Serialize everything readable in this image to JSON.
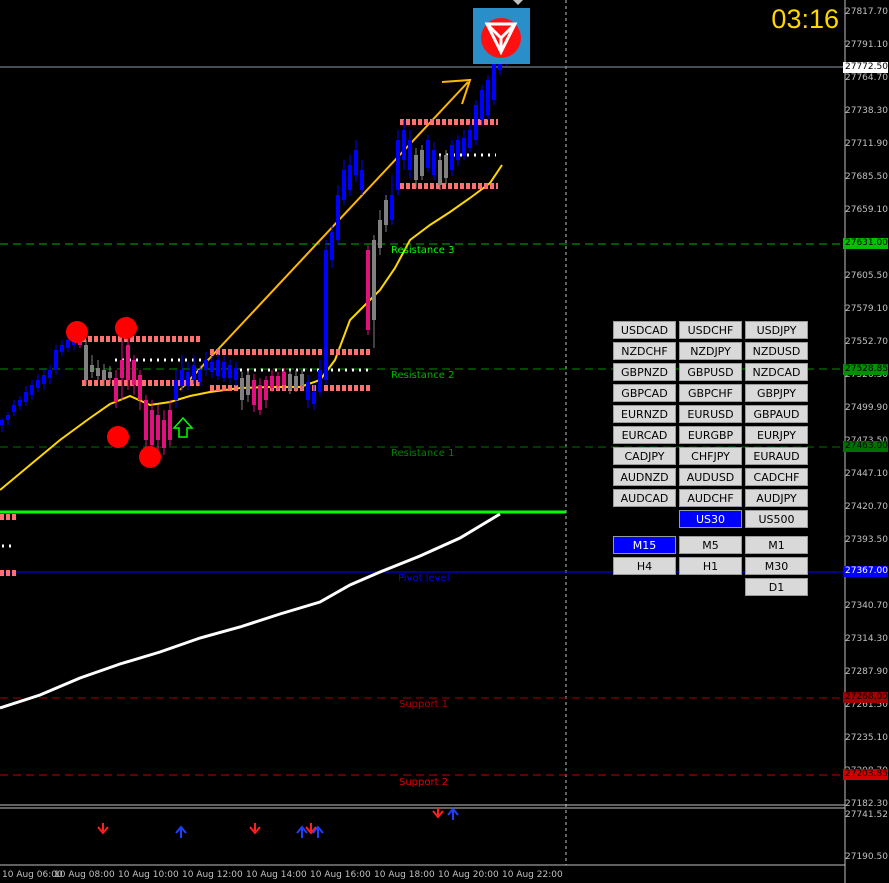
{
  "clock": "03:16",
  "price_axis": [
    "27817.70",
    "27791.10",
    "27764.70",
    "27738.30",
    "27711.90",
    "27685.50",
    "27659.10",
    "27632.70",
    "27605.50",
    "27579.10",
    "27552.70",
    "27526.30",
    "27499.90",
    "27473.50",
    "27447.10",
    "27420.70",
    "27393.50",
    "27367.10",
    "27340.70",
    "27314.30",
    "27287.90",
    "27261.50",
    "27235.10",
    "27208.70",
    "27182.30"
  ],
  "price_tags": {
    "current": "27772.50",
    "resistance3": "27631.00",
    "resistance2": "27528.85",
    "resistance1": "27463.00",
    "pivot": "27367.00",
    "support1": "27268.00",
    "support2": "27203.85"
  },
  "sub_axis": [
    "27741.52",
    "27190.50"
  ],
  "levels": {
    "resistance3": "Resistance 3",
    "resistance2": "Resistance 2",
    "resistance1": "Resistance 1",
    "pivot": "Pivot level",
    "support1": "Support 1",
    "support2": "Support 2"
  },
  "time_axis": [
    "10 Aug 06:00",
    "10 Aug 08:00",
    "10 Aug 10:00",
    "10 Aug 12:00",
    "10 Aug 14:00",
    "10 Aug 16:00",
    "10 Aug 18:00",
    "10 Aug 20:00",
    "10 Aug 22:00"
  ],
  "pairs": [
    [
      "USDCAD",
      "USDCHF",
      "USDJPY"
    ],
    [
      "NZDCHF",
      "NZDJPY",
      "NZDUSD"
    ],
    [
      "GBPNZD",
      "GBPUSD",
      "NZDCAD"
    ],
    [
      "GBPCAD",
      "GBPCHF",
      "GBPJPY"
    ],
    [
      "EURNZD",
      "EURUSD",
      "GBPAUD"
    ],
    [
      "EURCAD",
      "EURGBP",
      "EURJPY"
    ],
    [
      "CADJPY",
      "CHFJPY",
      "EURAUD"
    ],
    [
      "AUDNZD",
      "AUDUSD",
      "CADCHF"
    ],
    [
      "AUDCAD",
      "AUDCHF",
      "AUDJPY"
    ]
  ],
  "indices": [
    "US30",
    "US500"
  ],
  "active_symbol": "US30",
  "timeframes": [
    [
      "M15",
      "M5",
      "M1"
    ],
    [
      "H4",
      "H1",
      "M30"
    ],
    [
      "",
      "",
      "D1"
    ]
  ],
  "active_timeframe": "M15",
  "colors": {
    "bull": "#0000ff",
    "bear": "#e0107f",
    "neutral": "#808080",
    "ma_yellow": "#ffcc00",
    "ma_white": "#ffffff",
    "resistance": "#00cc00",
    "support": "#cc0000",
    "pivot": "#0000ff",
    "green_line": "#00ff00"
  }
}
